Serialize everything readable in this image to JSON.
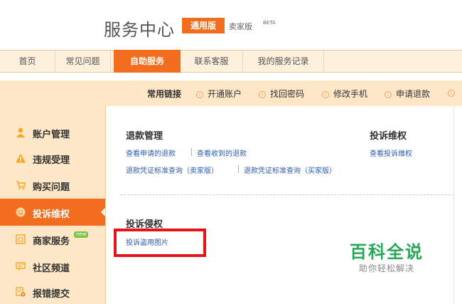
{
  "header": {
    "site_title": "服务中心",
    "version_active": "通用版",
    "version_seller": "卖家版",
    "beta": "BETA"
  },
  "nav": {
    "items": [
      "首页",
      "常见问题",
      "自助服务",
      "联系客服",
      "我的服务记录"
    ],
    "active_index": 2
  },
  "quick_links": {
    "label": "常用链接",
    "items": [
      "开通账户",
      "找回密码",
      "修改手机",
      "申请退款"
    ]
  },
  "sidebar": {
    "items": [
      {
        "label": "账户管理",
        "icon": "person-icon"
      },
      {
        "label": "违规受理",
        "icon": "warning-icon"
      },
      {
        "label": "购买问题",
        "icon": "cart-icon"
      },
      {
        "label": "投诉维权",
        "icon": "smiley-icon"
      },
      {
        "label": "商家服务",
        "icon": "shop-icon",
        "badge": "new"
      },
      {
        "label": "社区频道",
        "icon": "chat-icon"
      },
      {
        "label": "报错提交",
        "icon": "report-icon"
      }
    ],
    "active_index": 3
  },
  "main": {
    "refund": {
      "title": "退款管理",
      "links": [
        "查看申请的退款",
        "查看收到的退款",
        "退款凭证标准查询（卖家版）",
        "退款凭证标准查询（买家版）"
      ]
    },
    "complaint": {
      "title": "投诉维权",
      "links": [
        "查看投诉维权"
      ]
    },
    "infringe": {
      "title": "投诉侵权",
      "links": [
        "投诉盗用图片"
      ]
    }
  },
  "watermark": {
    "main": "百科全说",
    "sub": "助你轻松解决"
  },
  "colors": {
    "accent": "#f26d1d",
    "nav_bg": "#fdf0dc",
    "side_bg": "#fde7c6",
    "link": "#2a5db0",
    "highlight_box": "#e4141b",
    "watermark": "#2aa65a"
  }
}
